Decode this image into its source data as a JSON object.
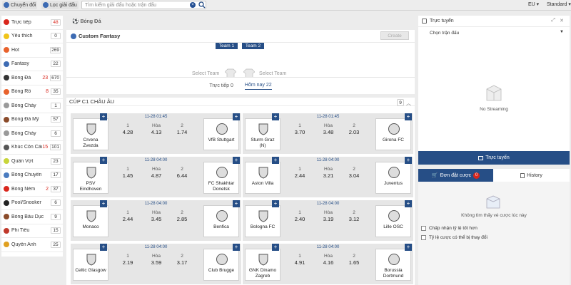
{
  "topbar": {
    "convert_label": "Chuyển đổi",
    "filter_label": "Lọc giải đấu",
    "search_placeholder": "Tìm kiếm giải đấu hoặc trận đấu",
    "region": "EU",
    "odds_mode": "Standard"
  },
  "sidebar": [
    {
      "label": "Trực tiếp",
      "live": "",
      "count": "48",
      "red": true,
      "color": "#d9261c"
    },
    {
      "label": "Yêu thích",
      "live": "",
      "count": "0",
      "red": false,
      "color": "#f0c419"
    },
    {
      "label": "Hot",
      "live": "",
      "count": "269",
      "red": false,
      "color": "#e8622c"
    },
    {
      "label": "Fantasy",
      "live": "",
      "count": "22",
      "red": false,
      "color": "#3d6bb3"
    },
    {
      "label": "Bóng Đá",
      "live": "23",
      "count": "670",
      "red": false,
      "color": "#333333"
    },
    {
      "label": "Bóng Rổ",
      "live": "8",
      "count": "35",
      "red": false,
      "color": "#e8622c"
    },
    {
      "label": "Bóng Chày",
      "live": "",
      "count": "1",
      "red": false,
      "color": "#999999"
    },
    {
      "label": "Bóng Đá Mỹ",
      "live": "",
      "count": "57",
      "red": false,
      "color": "#8a4b2a"
    },
    {
      "label": "Bóng Chày",
      "live": "",
      "count": "6",
      "red": false,
      "color": "#999999"
    },
    {
      "label": "Khúc Côn Cầu",
      "live": "15",
      "count": "101",
      "red": false,
      "color": "#555555"
    },
    {
      "label": "Quần Vợt",
      "live": "",
      "count": "23",
      "red": false,
      "color": "#c8d53a"
    },
    {
      "label": "Bóng Chuyền",
      "live": "",
      "count": "17",
      "red": false,
      "color": "#4a7bbf"
    },
    {
      "label": "Bóng Ném",
      "live": "2",
      "count": "37",
      "red": false,
      "color": "#d9261c"
    },
    {
      "label": "Pool/Snooker",
      "live": "",
      "count": "6",
      "red": false,
      "color": "#222222"
    },
    {
      "label": "Bóng Bầu Dục",
      "live": "",
      "count": "9",
      "red": false,
      "color": "#8a4b2a"
    },
    {
      "label": "Phi Tiêu",
      "live": "",
      "count": "15",
      "red": false,
      "color": "#c0392b"
    },
    {
      "label": "Quyền Anh",
      "live": "",
      "count": "25",
      "red": false,
      "color": "#e0a020"
    }
  ],
  "main": {
    "sport_title": "Bóng Đá",
    "fantasy": {
      "title": "Custom Fantasy",
      "create_label": "Create",
      "team1_label": "Team 1",
      "team2_label": "Team 2",
      "select_team": "Select Team"
    },
    "tabs": {
      "live": "Trực tiếp 0",
      "today": "Hôm nay 22"
    },
    "league": {
      "name": "CÚP C1 CHÂU ÂU",
      "count": "9"
    },
    "odds_labels": {
      "home": "1",
      "draw": "Hòa",
      "away": "2"
    },
    "matches": [
      {
        "time": "11-28 01:45",
        "home": "Crvena Zvezda",
        "away": "VfB Stuttgart",
        "o1": "4.28",
        "ox": "4.13",
        "o2": "1.74"
      },
      {
        "time": "11-28 01:45",
        "home": "Sturm Graz (N)",
        "away": "Girona FC",
        "o1": "3.70",
        "ox": "3.48",
        "o2": "2.03"
      },
      {
        "time": "11-28 04:00",
        "home": "PSV Eindhoven",
        "away": "FC Shakhtar Donetsk",
        "o1": "1.45",
        "ox": "4.87",
        "o2": "6.44"
      },
      {
        "time": "11-28 04:00",
        "home": "Aston Villa",
        "away": "Juventus",
        "o1": "2.44",
        "ox": "3.21",
        "o2": "3.04"
      },
      {
        "time": "11-28 04:00",
        "home": "Monaco",
        "away": "Benfica",
        "o1": "2.44",
        "ox": "3.45",
        "o2": "2.85"
      },
      {
        "time": "11-28 04:00",
        "home": "Bologna FC",
        "away": "Lille OSC",
        "o1": "2.40",
        "ox": "3.19",
        "o2": "3.12"
      },
      {
        "time": "11-28 04:00",
        "home": "Celtic Glasgow",
        "away": "Club Brugge",
        "o1": "2.19",
        "ox": "3.59",
        "o2": "3.17"
      },
      {
        "time": "11-28 04:00",
        "home": "GNK Dinamo Zagreb",
        "away": "Borussia Dortmund",
        "o1": "4.91",
        "ox": "4.16",
        "o2": "1.65"
      }
    ]
  },
  "right": {
    "live_title": "Trực tuyến",
    "select_match": "Chọn trận đấu",
    "no_streaming": "No Streaming",
    "live_button": "Trực tuyến",
    "bets_tab": "Đơn đặt cược",
    "bets_count": "0",
    "history_tab": "History",
    "no_bets": "Không tìm thấy vé cược lúc này",
    "accept_better": "Chấp nhận tỷ lệ tốt hơn",
    "odds_may_change": "Tỷ lệ cược có thể bị thay đổi"
  },
  "colors": {
    "accent": "#264e86",
    "live_red": "#d9261c"
  }
}
